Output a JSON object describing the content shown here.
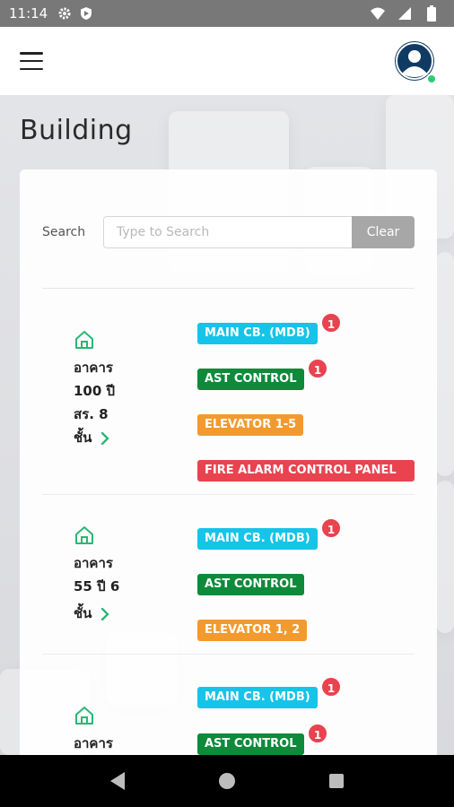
{
  "status_bar": {
    "time": "11:14"
  },
  "page": {
    "title": "Building"
  },
  "search": {
    "label": "Search",
    "placeholder": "Type to Search",
    "value": "",
    "clear_label": "Clear"
  },
  "buildings": [
    {
      "name_lines": [
        "อาคาร",
        "100 ปี",
        "สร. 8",
        "ชั้น"
      ],
      "systems": [
        {
          "label": "MAIN CB. (MDB)",
          "color": "cyan",
          "badge": "1"
        },
        {
          "label": "AST CONTROL",
          "color": "green",
          "badge": "1"
        },
        {
          "label": "ELEVATOR 1-5",
          "color": "orange",
          "badge": ""
        },
        {
          "label": "FIRE ALARM CONTROL PANEL",
          "color": "red",
          "badge": ""
        }
      ]
    },
    {
      "name_lines": [
        "อาคาร",
        "55 ปี 6",
        "ชั้น"
      ],
      "systems": [
        {
          "label": "MAIN CB. (MDB)",
          "color": "cyan",
          "badge": "1"
        },
        {
          "label": "AST CONTROL",
          "color": "green",
          "badge": ""
        },
        {
          "label": "ELEVATOR 1, 2",
          "color": "orange",
          "badge": ""
        }
      ]
    },
    {
      "name_lines": [
        "อาคาร"
      ],
      "systems": [
        {
          "label": "MAIN CB. (MDB)",
          "color": "cyan",
          "badge": "1"
        },
        {
          "label": "AST CONTROL",
          "color": "green",
          "badge": "1"
        }
      ]
    }
  ],
  "colors": {
    "cyan": "#15c4e8",
    "green": "#0e8a3a",
    "orange": "#f39a2f",
    "red": "#e8434f",
    "accent_icon": "#2bb673"
  },
  "icons": [
    "gear-icon",
    "shield-icon",
    "wifi-icon",
    "signal-icon",
    "battery-icon",
    "menu-icon",
    "user-avatar-icon",
    "home-icon",
    "chevron-right-icon",
    "back-icon",
    "home-nav-icon",
    "recents-icon"
  ]
}
